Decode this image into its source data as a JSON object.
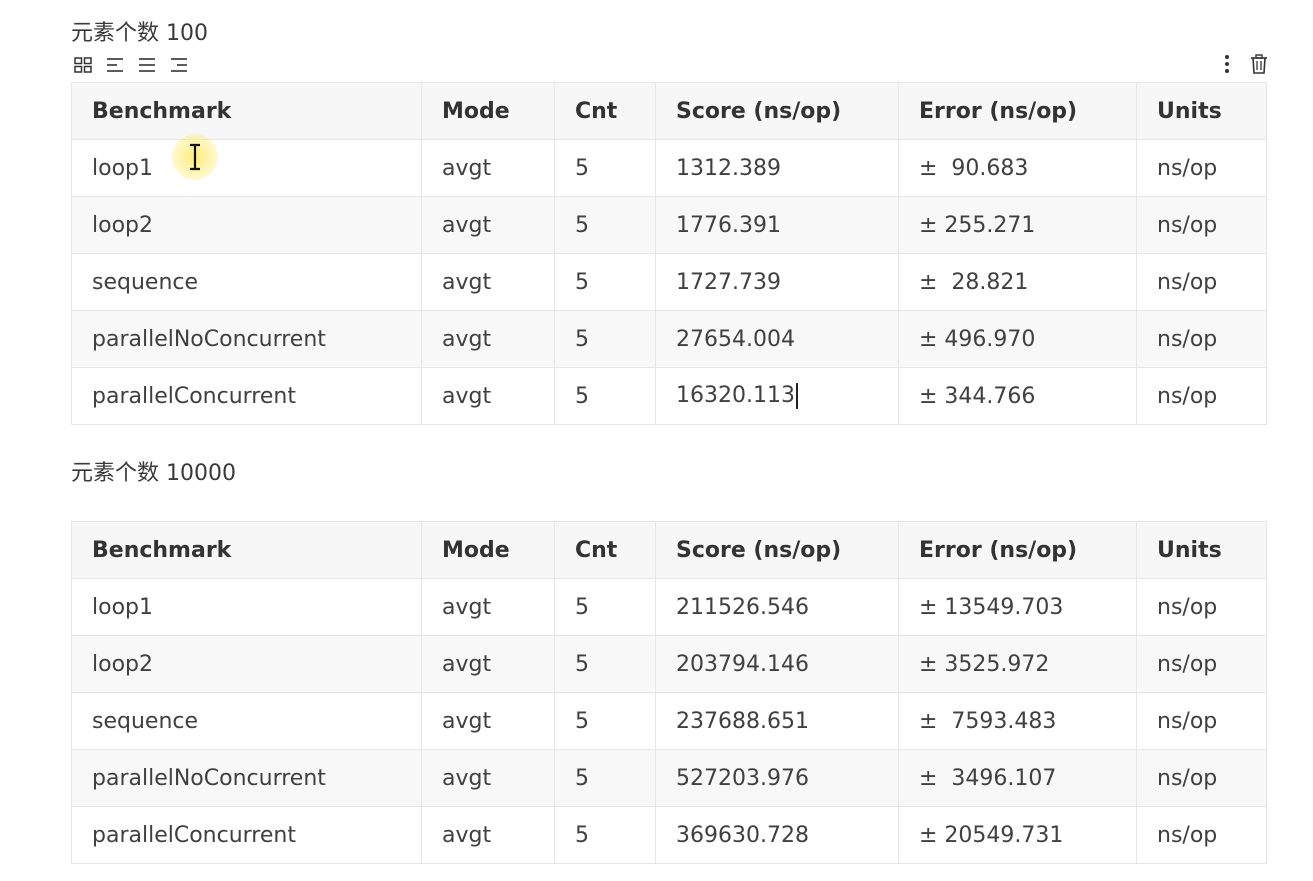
{
  "sections": [
    {
      "heading": "元素个数 100",
      "columns": [
        "Benchmark",
        "Mode",
        "Cnt",
        "Score (ns/op)",
        "Error (ns/op)",
        "Units"
      ],
      "rows": [
        [
          "loop1",
          "avgt",
          "5",
          "1312.389",
          "±  90.683",
          "ns/op"
        ],
        [
          "loop2",
          "avgt",
          "5",
          "1776.391",
          "± 255.271",
          "ns/op"
        ],
        [
          "sequence",
          "avgt",
          "5",
          "1727.739",
          "±  28.821",
          "ns/op"
        ],
        [
          "parallelNoConcurrent",
          "avgt",
          "5",
          "27654.004",
          "± 496.970",
          "ns/op"
        ],
        [
          "parallelConcurrent",
          "avgt",
          "5",
          "16320.113",
          "± 344.766",
          "ns/op"
        ]
      ]
    },
    {
      "heading": "元素个数 10000",
      "columns": [
        "Benchmark",
        "Mode",
        "Cnt",
        "Score (ns/op)",
        "Error (ns/op)",
        "Units"
      ],
      "rows": [
        [
          "loop1",
          "avgt",
          "5",
          "211526.546",
          "± 13549.703",
          "ns/op"
        ],
        [
          "loop2",
          "avgt",
          "5",
          "203794.146",
          "± 3525.972",
          "ns/op"
        ],
        [
          "sequence",
          "avgt",
          "5",
          "237688.651",
          "±  7593.483",
          "ns/op"
        ],
        [
          "parallelNoConcurrent",
          "avgt",
          "5",
          "527203.976",
          "±  3496.107",
          "ns/op"
        ],
        [
          "parallelConcurrent",
          "avgt",
          "5",
          "369630.728",
          "± 20549.731",
          "ns/op"
        ]
      ]
    }
  ],
  "toolbar": {
    "icons": [
      "table-grid-icon",
      "align-left-icon",
      "align-center-icon",
      "align-right-icon"
    ]
  },
  "actions": {
    "icons": [
      "more-vertical-icon",
      "trash-icon"
    ]
  }
}
